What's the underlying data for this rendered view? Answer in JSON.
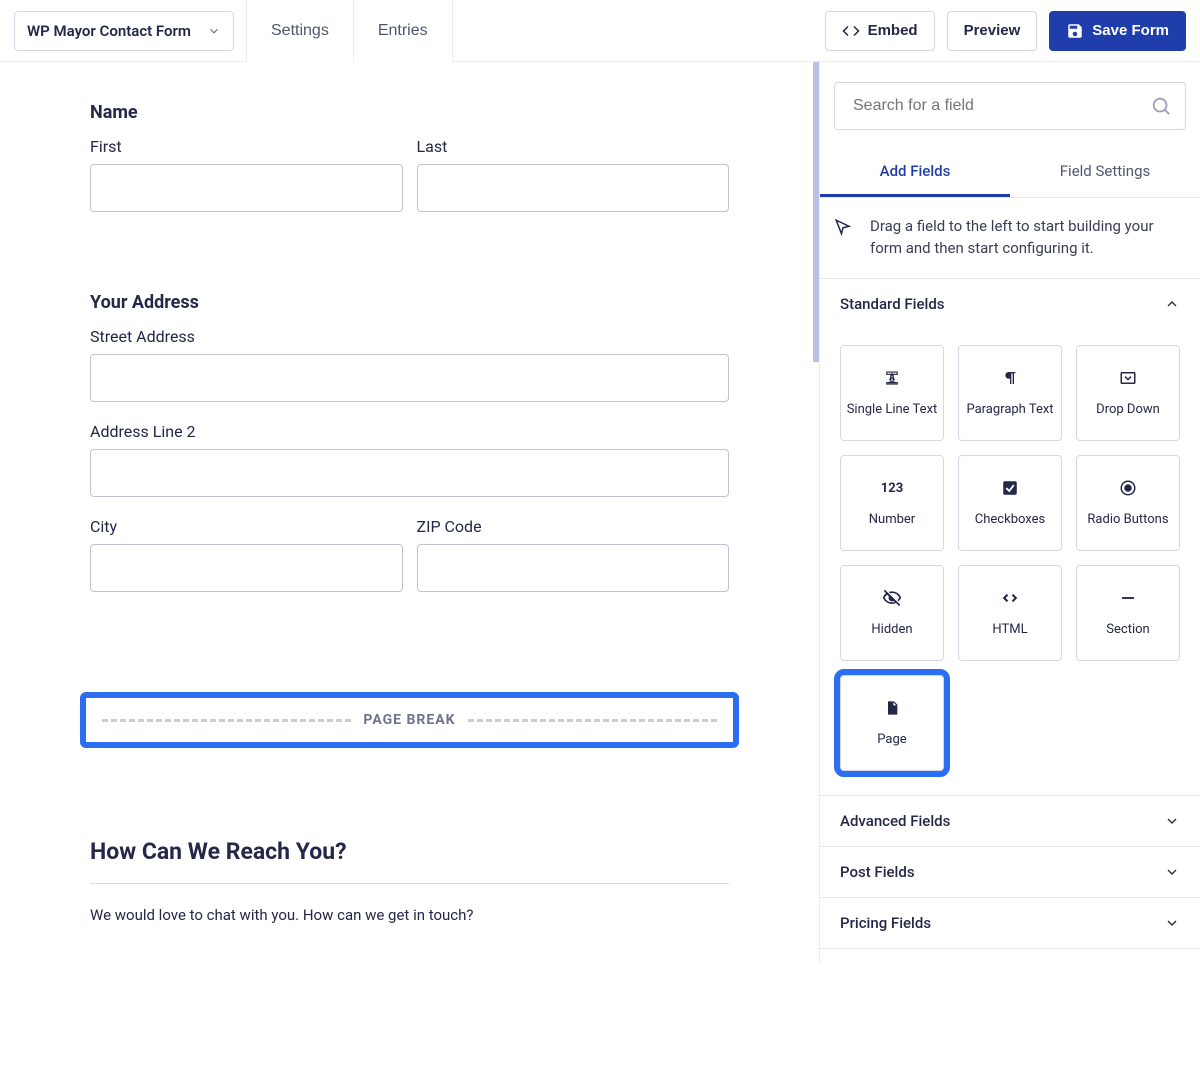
{
  "topbar": {
    "form_name": "WP Mayor Contact Form",
    "settings": "Settings",
    "entries": "Entries",
    "embed": "Embed",
    "preview": "Preview",
    "save": "Save Form"
  },
  "canvas": {
    "name": {
      "label": "Name",
      "first": "First",
      "last": "Last"
    },
    "address": {
      "label": "Your Address",
      "street": "Street Address",
      "line2": "Address Line 2",
      "city": "City",
      "zip": "ZIP Code"
    },
    "page_break": "PAGE BREAK",
    "reach": {
      "title": "How Can We Reach You?",
      "desc": "We would love to chat with you. How can we get in touch?"
    }
  },
  "sidebar": {
    "search_placeholder": "Search for a field",
    "tabs": {
      "add": "Add Fields",
      "settings": "Field Settings"
    },
    "help": "Drag a field to the left to start building your form and then start configuring it.",
    "sections": {
      "standard": "Standard Fields",
      "advanced": "Advanced Fields",
      "post": "Post Fields",
      "pricing": "Pricing Fields"
    },
    "fields": {
      "single": "Single Line Text",
      "paragraph": "Paragraph Text",
      "dropdown": "Drop Down",
      "number": "Number",
      "checkboxes": "Checkboxes",
      "radio": "Radio Buttons",
      "hidden": "Hidden",
      "html": "HTML",
      "section": "Section",
      "page": "Page"
    }
  }
}
